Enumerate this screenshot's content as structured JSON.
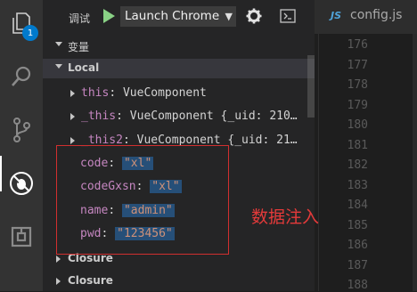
{
  "activity_bar": {
    "items": [
      {
        "icon": "files-icon",
        "badge": "1"
      },
      {
        "icon": "search-icon"
      },
      {
        "icon": "source-control-icon"
      },
      {
        "icon": "debug-icon"
      },
      {
        "icon": "extensions-icon"
      }
    ]
  },
  "debug_toolbar": {
    "label": "调试",
    "configuration": "Launch Chrome",
    "play_icon": "play-icon",
    "gear_icon": "gear-icon",
    "console_icon": "console-icon"
  },
  "variables": {
    "section_title": "变量",
    "scopes": [
      {
        "label": "Local",
        "expanded": true
      },
      {
        "label": "Closure",
        "expanded": false
      },
      {
        "label": "Closure",
        "expanded": false
      }
    ],
    "local_items": [
      {
        "name": "this",
        "value": "VueComponent",
        "expandable": true
      },
      {
        "name": "_this",
        "value": "VueComponent {_uid: 210…",
        "expandable": true
      },
      {
        "name": "_this2",
        "value": "VueComponent {_uid: 21…",
        "expandable": true
      },
      {
        "name": "code",
        "value": "\"xl\"",
        "expandable": false
      },
      {
        "name": "codeGxsn",
        "value": "\"xl\"",
        "expandable": false
      },
      {
        "name": "name",
        "value": "\"admin\"",
        "expandable": false
      },
      {
        "name": "pwd",
        "value": "\"123456\"",
        "expandable": false
      }
    ]
  },
  "editor": {
    "tab": {
      "badge": "JS",
      "filename": "config.js"
    },
    "line_numbers": [
      "176",
      "177",
      "178",
      "179",
      "180",
      "181",
      "182",
      "183",
      "184",
      "185",
      "186",
      "187",
      "188"
    ]
  },
  "annotation": {
    "text": "数据注入",
    "color": "#e53a3a"
  },
  "colors": {
    "accent": "#007acc",
    "play": "#89d185",
    "var_name": "#c586c0",
    "string_value": "#ce9178"
  }
}
